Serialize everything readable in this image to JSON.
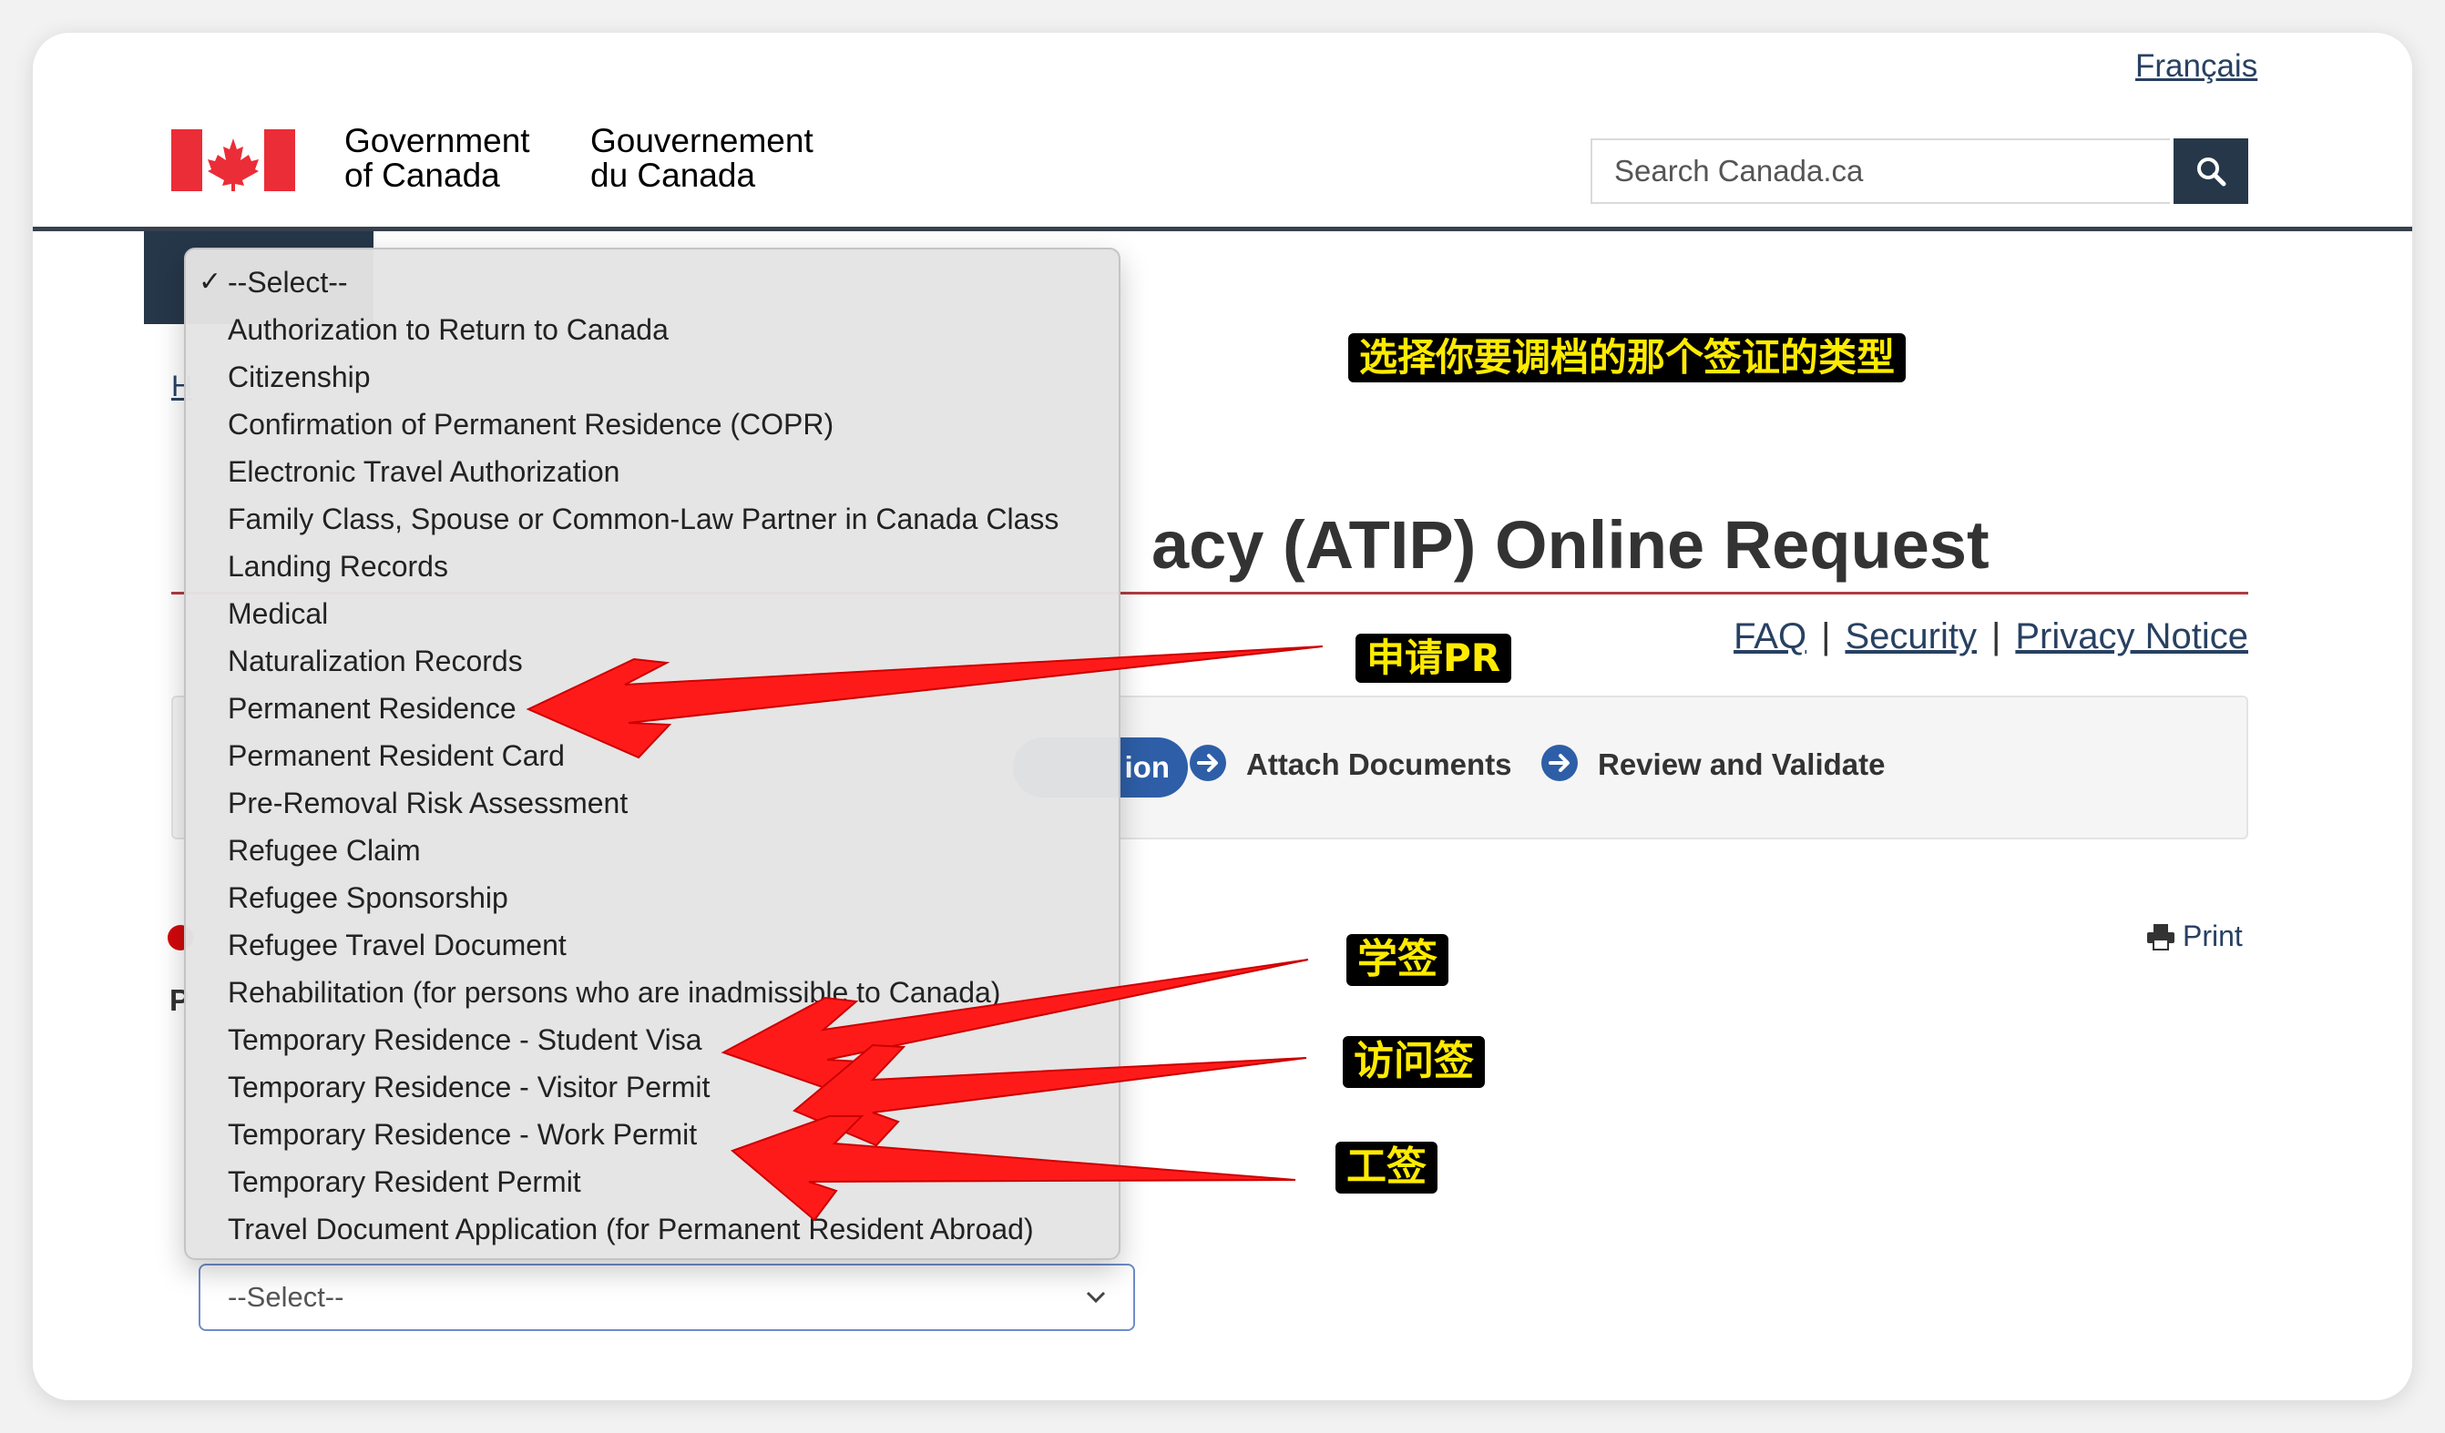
{
  "header": {
    "language_link": "Français",
    "wordmark_en_line1": "Government",
    "wordmark_en_line2": "of Canada",
    "wordmark_fr_line1": "Gouvernement",
    "wordmark_fr_line2": "du Canada",
    "search_placeholder": "Search Canada.ca"
  },
  "page": {
    "title_visible": "acy (ATIP) Online Request",
    "breadcrumb_fragment": "H",
    "label_fragment": "P",
    "links": [
      "FAQ",
      "Security",
      "Privacy Notice"
    ],
    "print_label": "Print"
  },
  "steps": {
    "active_fragment": "ion",
    "items": [
      "Attach Documents",
      "Review and Validate"
    ]
  },
  "select": {
    "value": "--Select--",
    "options": [
      "--Select--",
      "Authorization to Return to Canada",
      "Citizenship",
      "Confirmation of Permanent Residence (COPR)",
      "Electronic Travel Authorization",
      "Family Class, Spouse or Common-Law Partner in Canada Class",
      "Landing Records",
      "Medical",
      "Naturalization Records",
      "Permanent Residence",
      "Permanent Resident Card",
      "Pre-Removal Risk Assessment",
      "Refugee Claim",
      "Refugee Sponsorship",
      "Refugee Travel Document",
      "Rehabilitation (for persons who are inadmissible to Canada)",
      "Temporary Residence - Student Visa",
      "Temporary Residence - Visitor Permit",
      "Temporary Residence - Work Permit",
      "Temporary Resident Permit",
      "Travel Document Application (for Permanent Resident Abroad)"
    ],
    "selected_index": 0
  },
  "annotations": {
    "heading": "选择你要调档的那个签证的类型",
    "pr": "申请PR",
    "student": "学签",
    "visitor": "访问签",
    "work": "工签"
  },
  "colors": {
    "gc_red": "#eb2d37",
    "gc_navy": "#26374a",
    "link": "#284162",
    "step_blue": "#2e5ea7",
    "title_rule": "#af3c43",
    "callout_bg": "#000000",
    "callout_text": "#ffeb00",
    "arrow": "#ff1a1a"
  }
}
